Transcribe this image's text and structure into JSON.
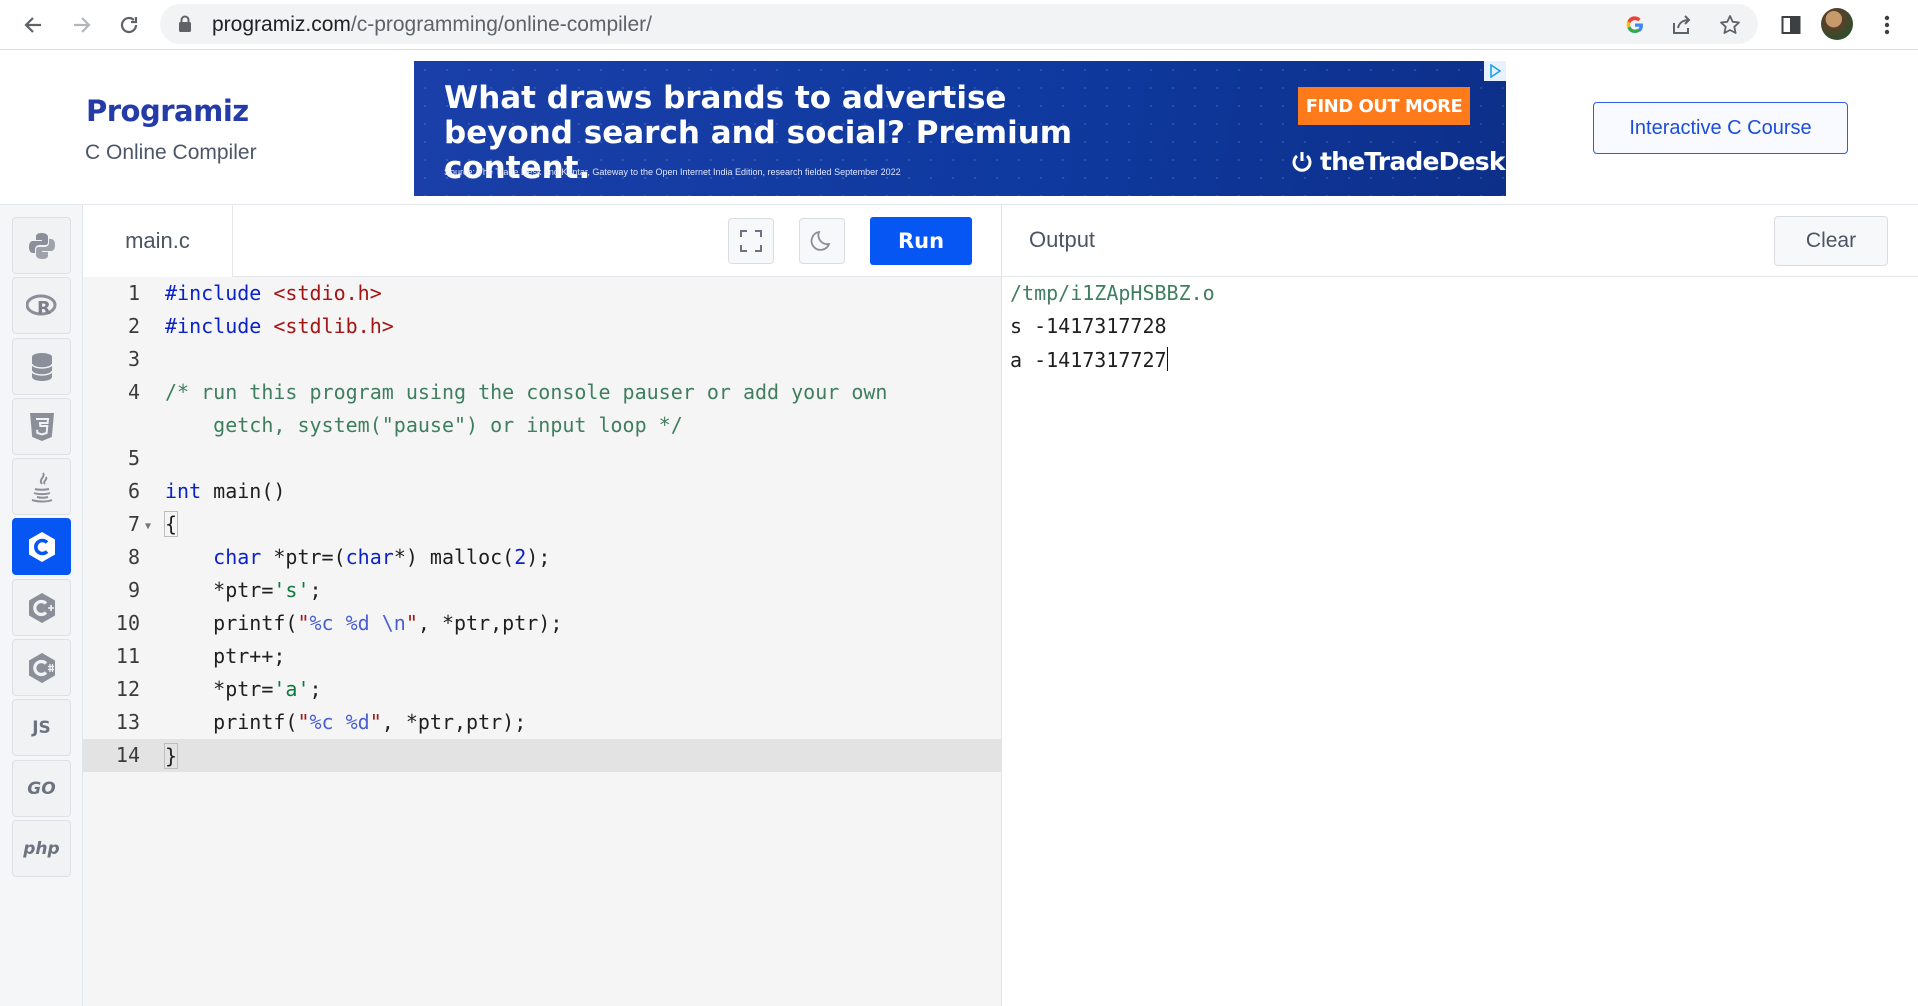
{
  "browser": {
    "url_domain": "programiz.com",
    "url_path": "/c-programming/online-compiler/"
  },
  "header": {
    "logo_text": "Programiz",
    "subtitle": "C Online Compiler",
    "course_button": "Interactive C Course"
  },
  "ad": {
    "headline": "What draws brands to advertise beyond search and social? Premium content.",
    "source": "Source: The Trade Desk and Kantar, Gateway to the Open Internet India Edition, research fielded September 2022",
    "cta": "FIND OUT MORE",
    "brand": "theTradeDesk"
  },
  "sidebar": {
    "languages": [
      {
        "name": "python",
        "icon": "python-icon",
        "active": false
      },
      {
        "name": "r",
        "icon": "r-icon",
        "active": false
      },
      {
        "name": "sql",
        "icon": "database-icon",
        "active": false
      },
      {
        "name": "html",
        "icon": "html5-icon",
        "active": false
      },
      {
        "name": "java",
        "icon": "java-icon",
        "active": false
      },
      {
        "name": "c",
        "icon": "c-icon",
        "active": true
      },
      {
        "name": "cpp",
        "icon": "cpp-icon",
        "active": false
      },
      {
        "name": "csharp",
        "icon": "csharp-icon",
        "active": false
      },
      {
        "name": "javascript",
        "label": "JS",
        "active": false
      },
      {
        "name": "go",
        "label": "GO",
        "active": false
      },
      {
        "name": "php",
        "label": "php",
        "active": false
      }
    ]
  },
  "editor": {
    "filename": "main.c",
    "run_label": "Run",
    "lines": [
      {
        "num": "1",
        "text": "#include <stdio.h>"
      },
      {
        "num": "2",
        "text": "#include <stdlib.h>"
      },
      {
        "num": "3",
        "text": ""
      },
      {
        "num": "4",
        "text": "/* run this program using the console pauser or add your own"
      },
      {
        "num": "",
        "text": "    getch, system(\"pause\") or input loop */"
      },
      {
        "num": "5",
        "text": ""
      },
      {
        "num": "6",
        "text": "int main()"
      },
      {
        "num": "7",
        "text": "{"
      },
      {
        "num": "8",
        "text": "    char *ptr=(char*) malloc(2);"
      },
      {
        "num": "9",
        "text": "    *ptr='s';"
      },
      {
        "num": "10",
        "text": "    printf(\"%c %d \\n\", *ptr,ptr);"
      },
      {
        "num": "11",
        "text": "    ptr++;"
      },
      {
        "num": "12",
        "text": "    *ptr='a';"
      },
      {
        "num": "13",
        "text": "    printf(\"%c %d\", *ptr,ptr);"
      },
      {
        "num": "14",
        "text": "}"
      }
    ]
  },
  "output": {
    "title": "Output",
    "clear_label": "Clear",
    "lines": [
      "/tmp/i1ZApHSBBZ.o",
      "s -1417317728",
      "a -1417317727"
    ]
  },
  "colors": {
    "accent": "#0556f3",
    "ad_cta": "#ff7a1a",
    "ad_bg": "#1a3fa8"
  }
}
